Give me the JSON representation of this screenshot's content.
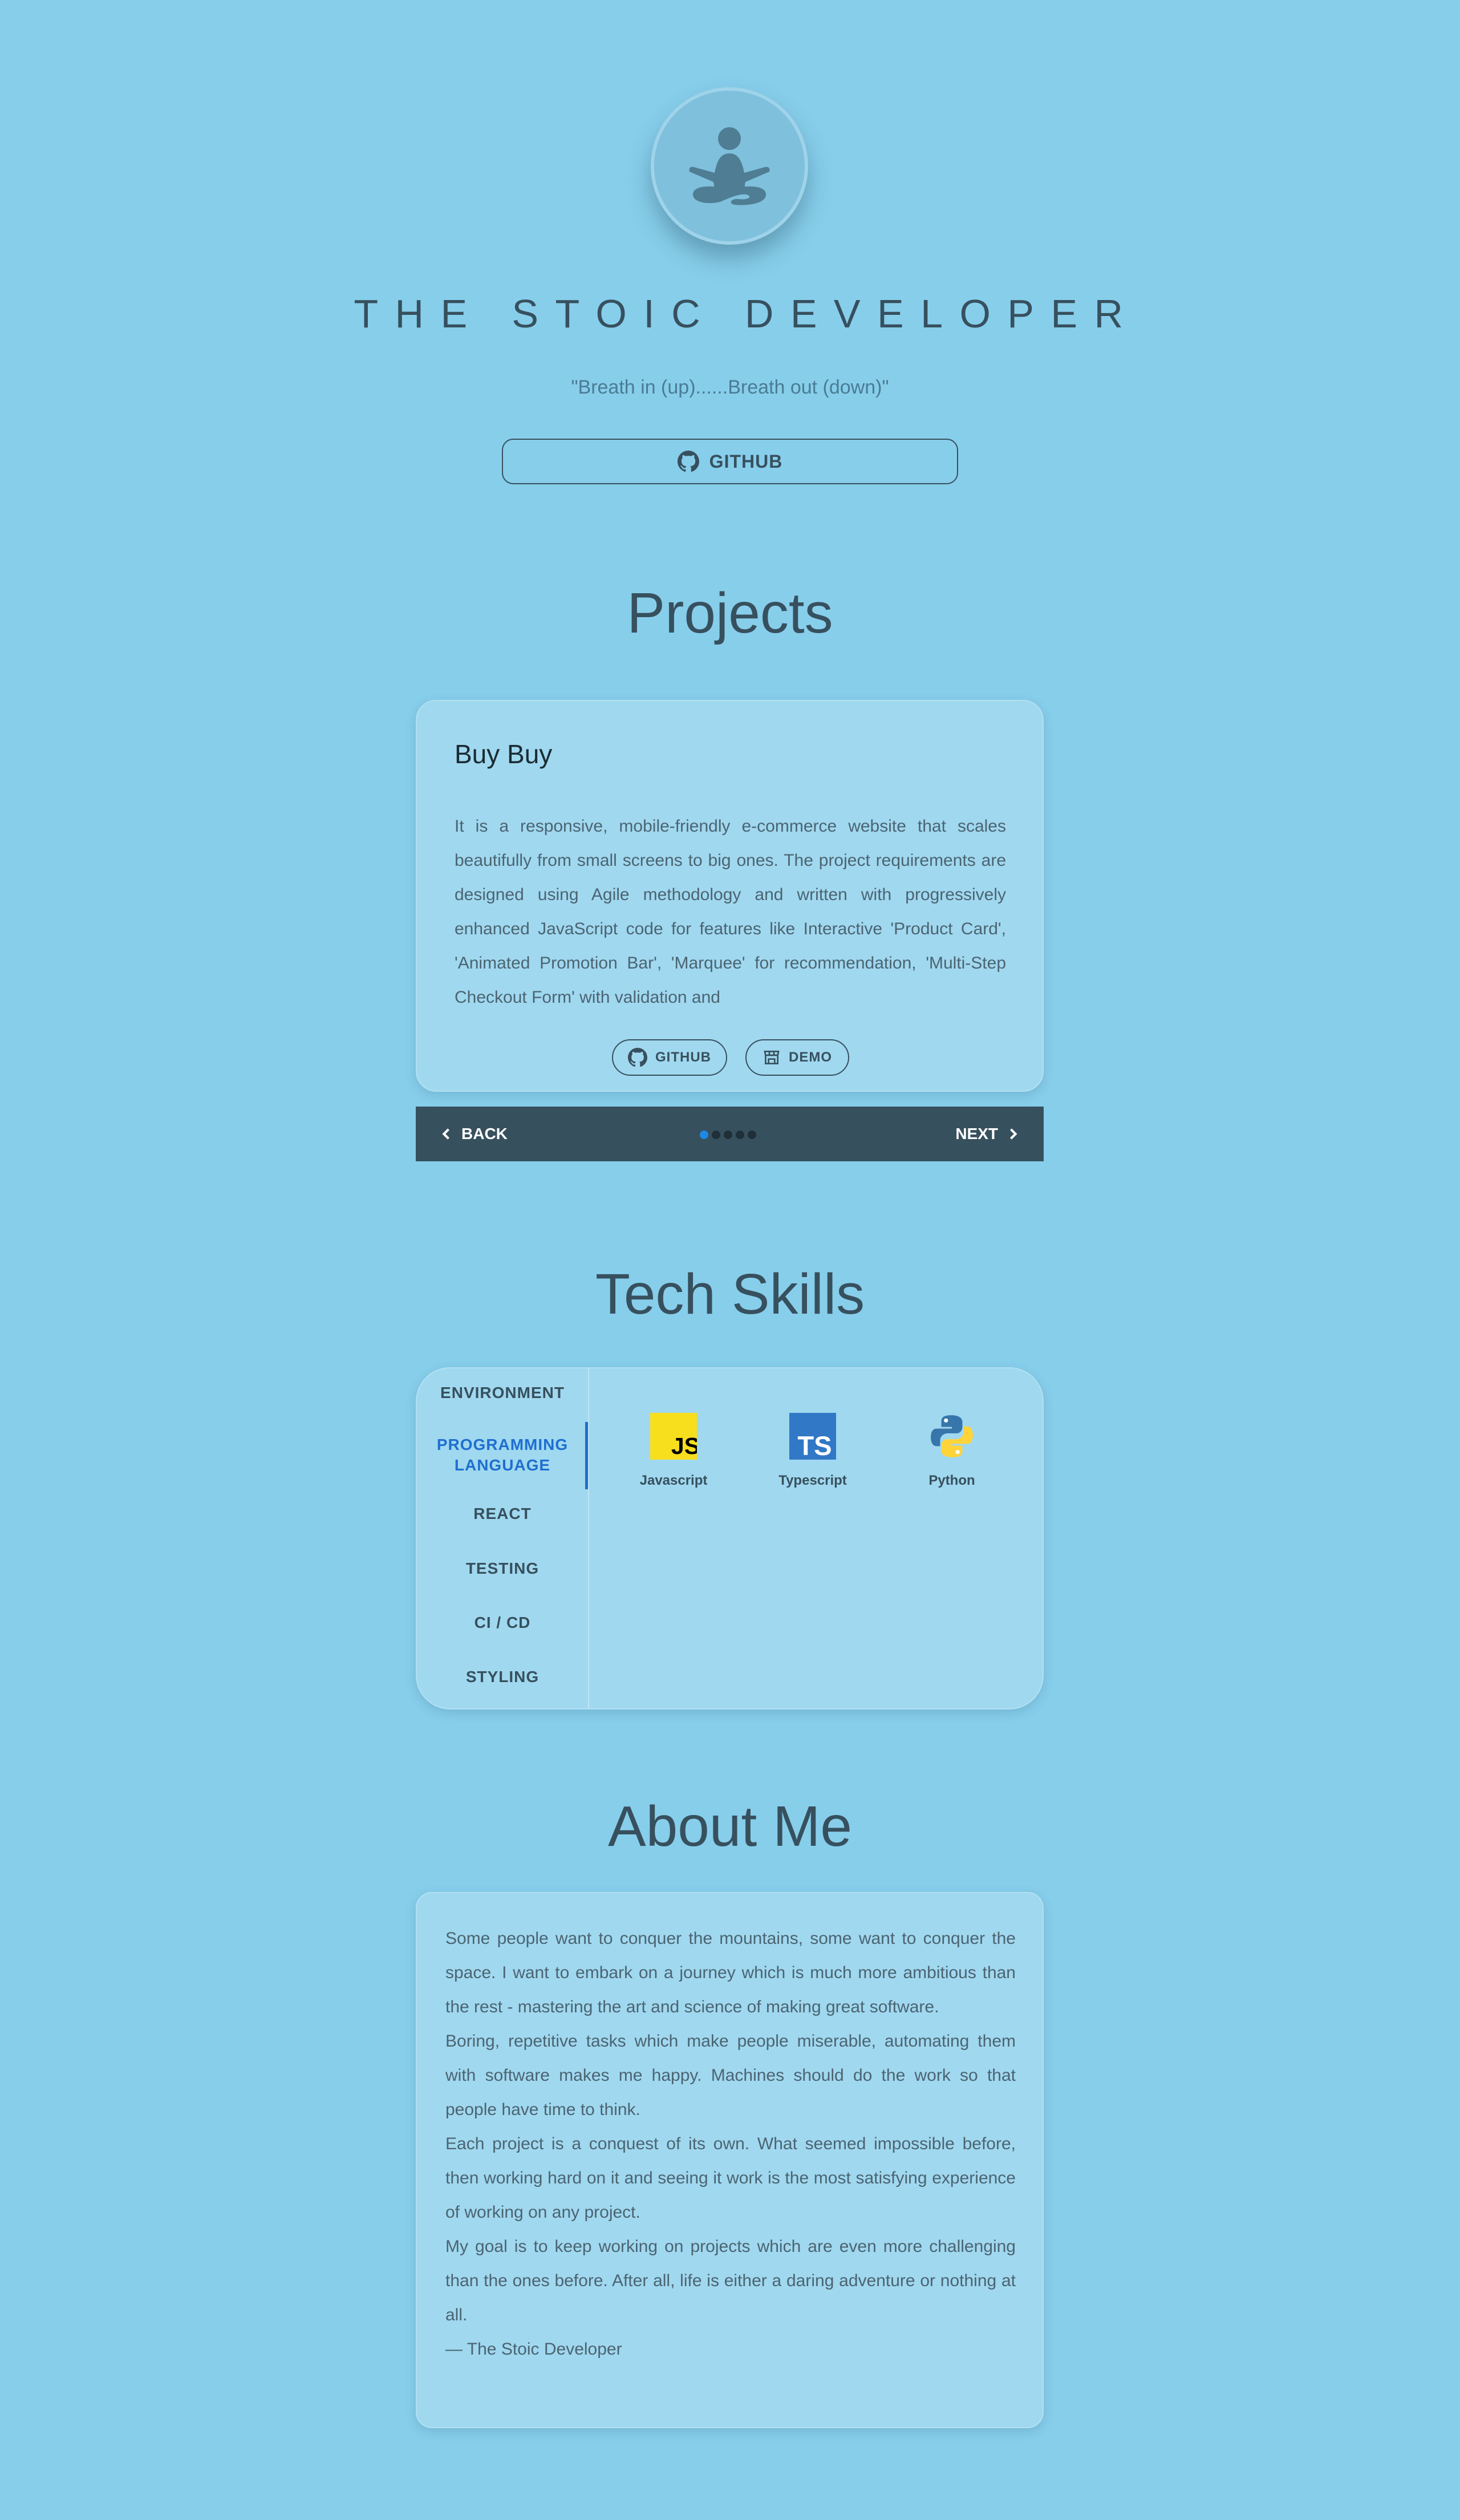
{
  "header": {
    "title": "THE STOIC DEVELOPER",
    "quote": "\"Breath in (up)......Breath out (down)\"",
    "github_label": "GITHUB",
    "avatar_icon": "meditation-icon"
  },
  "projects": {
    "title": "Projects",
    "current": {
      "name": "Buy Buy",
      "description": "It is a responsive, mobile-friendly e-commerce website that scales beautifully from small screens to big ones. The project requirements are designed using Agile methodology and written with progressively enhanced JavaScript code for features like Interactive 'Product Card', 'Animated Promotion Bar', 'Marquee' for recommendation, 'Multi-Step Checkout Form' with validation and",
      "github_label": "GITHUB",
      "demo_label": "DEMO"
    },
    "stepper": {
      "back_label": "BACK",
      "next_label": "NEXT",
      "steps_total": 5,
      "active_step": 1
    }
  },
  "skills": {
    "title": "Tech Skills",
    "tabs": [
      "ENVIRONMENT",
      "PROGRAMMING LANGUAGE",
      "REACT",
      "TESTING",
      "CI / CD",
      "STYLING"
    ],
    "active_tab": "PROGRAMMING LANGUAGE",
    "items": [
      {
        "name": "Javascript",
        "icon": "javascript-icon"
      },
      {
        "name": "Typescript",
        "icon": "typescript-icon"
      },
      {
        "name": "Python",
        "icon": "python-icon"
      }
    ]
  },
  "about": {
    "title": "About Me",
    "paragraphs": [
      "Some people want to conquer the mountains, some want to conquer the space. I want to embark on a journey which is much more ambitious than the rest - mastering the art and science of making great software.",
      "Boring, repetitive tasks which make people miserable, automating them with software makes me happy. Machines should do the work so that people have time to think.",
      "Each project is a conquest of its own. What seemed impossible before, then working hard on it and seeing it work is the most satisfying experience of working on any project.",
      "My goal is to keep working on projects which are even more challenging than the ones before. After all, life is either a daring adventure or nothing at all.",
      "— The Stoic Developer"
    ]
  },
  "colors": {
    "background": "#87ceeb",
    "card": "#a0d8ef",
    "text_dark": "#37505e",
    "accent": "#1e6fcf",
    "stepper_bg": "#37505e"
  }
}
